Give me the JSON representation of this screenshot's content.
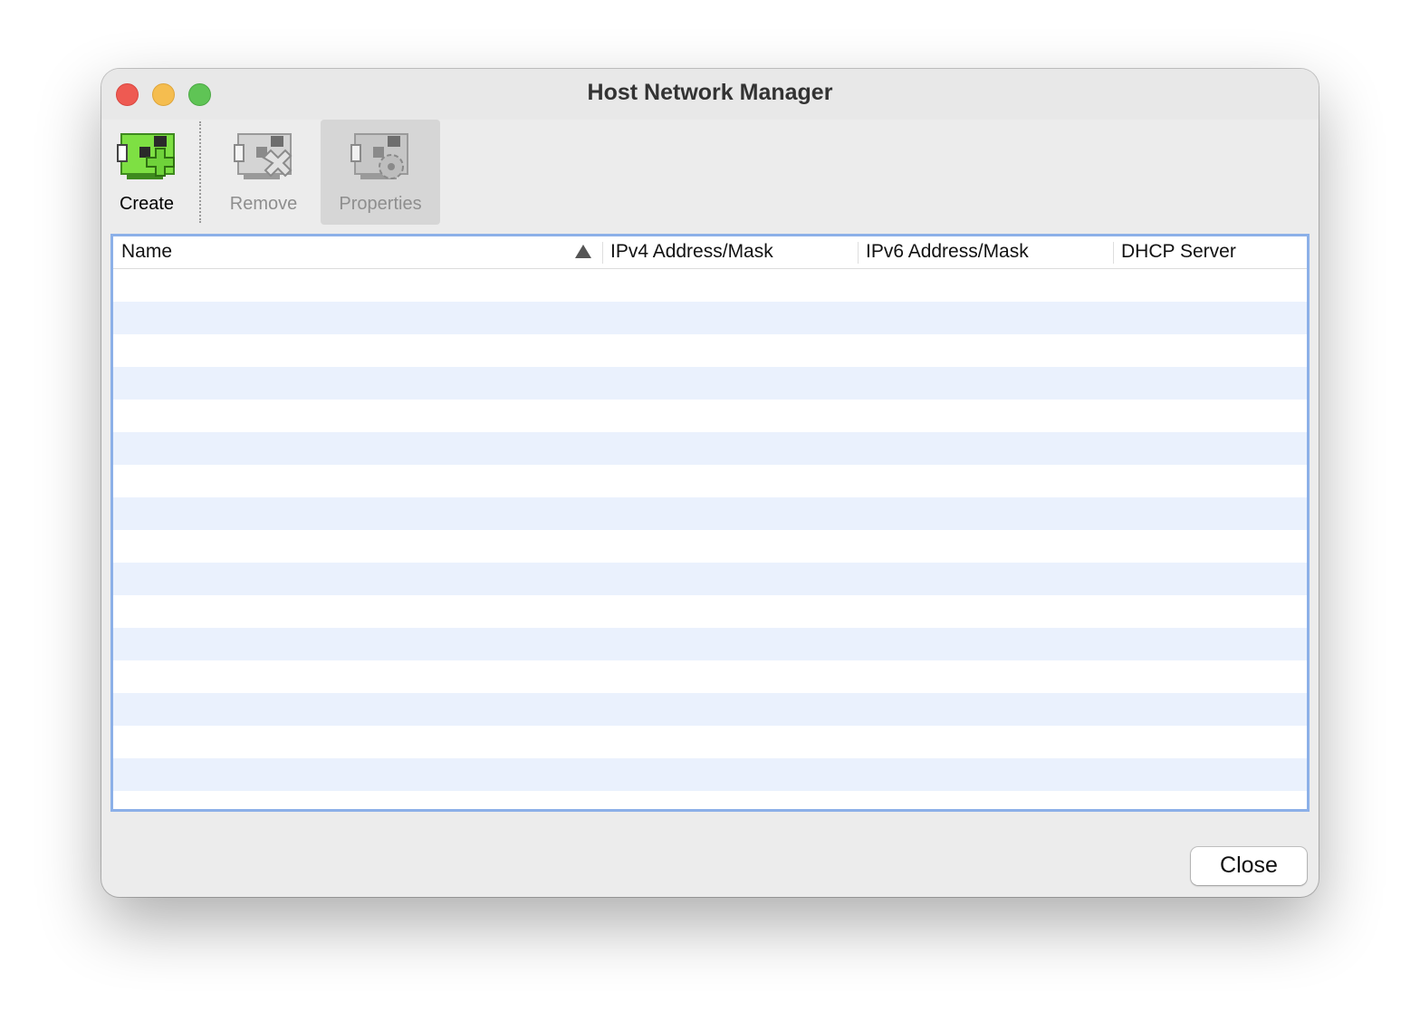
{
  "window": {
    "title": "Host Network Manager"
  },
  "toolbar": {
    "create": {
      "label": "Create",
      "icon": "network-adapter-add-icon",
      "enabled": true
    },
    "remove": {
      "label": "Remove",
      "icon": "network-adapter-remove-icon",
      "enabled": false
    },
    "properties": {
      "label": "Properties",
      "icon": "network-adapter-properties-icon",
      "enabled": false
    }
  },
  "table": {
    "columns": [
      {
        "label": "Name",
        "sorted": "ascending"
      },
      {
        "label": "IPv4 Address/Mask"
      },
      {
        "label": "IPv6 Address/Mask"
      },
      {
        "label": "DHCP Server"
      }
    ],
    "rows": []
  },
  "footer": {
    "close_label": "Close"
  },
  "colors": {
    "close": "#ee5a52",
    "minimize": "#f5bd4f",
    "maximize": "#5fc455",
    "focus_ring": "#8cb0e8",
    "alt_row": "#eaf1fd",
    "create_green": "#6fd23a"
  }
}
